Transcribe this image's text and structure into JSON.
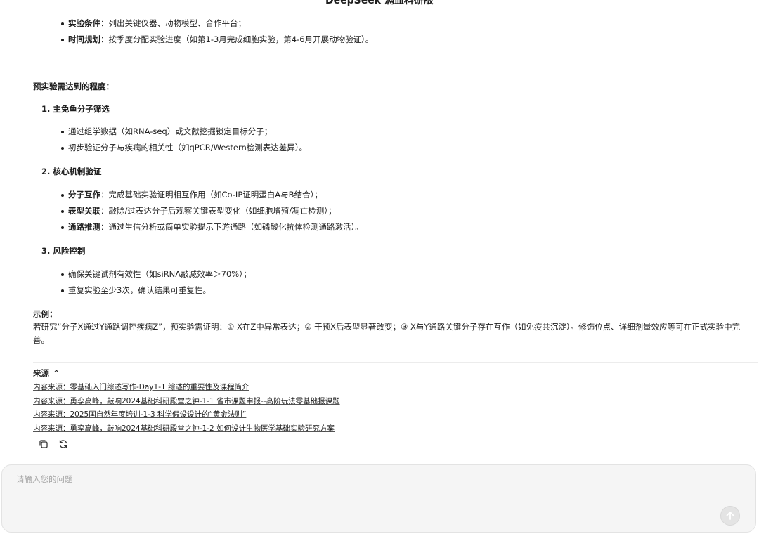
{
  "header": {
    "title": "DeepSeek 满血科研版"
  },
  "top_list": [
    {
      "label": "实验条件",
      "text": "：列出关键仪器、动物模型、合作平台；"
    },
    {
      "label": "时间规划",
      "text": "：按季度分配实验进度（如第1-3月完成细胞实验，第4-6月开展动物验证）。"
    }
  ],
  "prelim": {
    "heading": "预实验需达到的程度：",
    "sections": [
      {
        "title": "1. 主免鱼分子筛选",
        "items": [
          {
            "label": "",
            "text": "通过组学数据（如RNA-seq）或文献挖掘锁定目标分子；"
          },
          {
            "label": "",
            "text": "初步验证分子与疾病的相关性（如qPCR/Western检测表达差异）。"
          }
        ]
      },
      {
        "title": "2. 核心机制验证",
        "items": [
          {
            "label": "分子互作",
            "text": "：完成基础实验证明相互作用（如Co-IP证明蛋白A与B结合）；"
          },
          {
            "label": "表型关联",
            "text": "：敲除/过表达分子后观察关键表型变化（如细胞增殖/凋亡检测）；"
          },
          {
            "label": "通路推测",
            "text": "：通过生信分析或简单实验提示下游通路（如磷酸化抗体检测通路激活）。"
          }
        ]
      },
      {
        "title": "3. 风险控制",
        "items": [
          {
            "label": "",
            "text": "确保关键试剂有效性（如siRNA敲减效率＞70%）；"
          },
          {
            "label": "",
            "text": "重复实验至少3次，确认结果可重复性。"
          }
        ]
      }
    ]
  },
  "example": {
    "heading": "示例：",
    "body": "若研究“分子X通过Y通路调控疾病Z”，预实验需证明：① X在Z中异常表达；② 干预X后表型显著改变；③ X与Y通路关键分子存在互作（如免疫共沉淀）。修饰位点、详细剂量效应等可在正式实验中完善。"
  },
  "sources": {
    "heading": "来源",
    "links": [
      "内容来源：零基础入门综述写作-Day1-1 综述的重要性及课程简介",
      "内容来源：勇孪高峰，敲响2024基础科研殿堂之钟-1-1 省市课题申报--高阶玩法零基础报课题",
      "内容来源：2025国自然年度培训-1-3 科学假设设计的“黄金法则”",
      "内容来源：勇孪高峰，敲响2024基础科研殿堂之钟-1-2 如何设计生物医学基础实验研究方案"
    ]
  },
  "actions": {
    "copy_icon": "copy-icon",
    "regenerate_icon": "refresh-icon"
  },
  "input": {
    "placeholder": "请输入您的问题",
    "value": ""
  },
  "send": {
    "icon": "arrow-up-icon"
  }
}
